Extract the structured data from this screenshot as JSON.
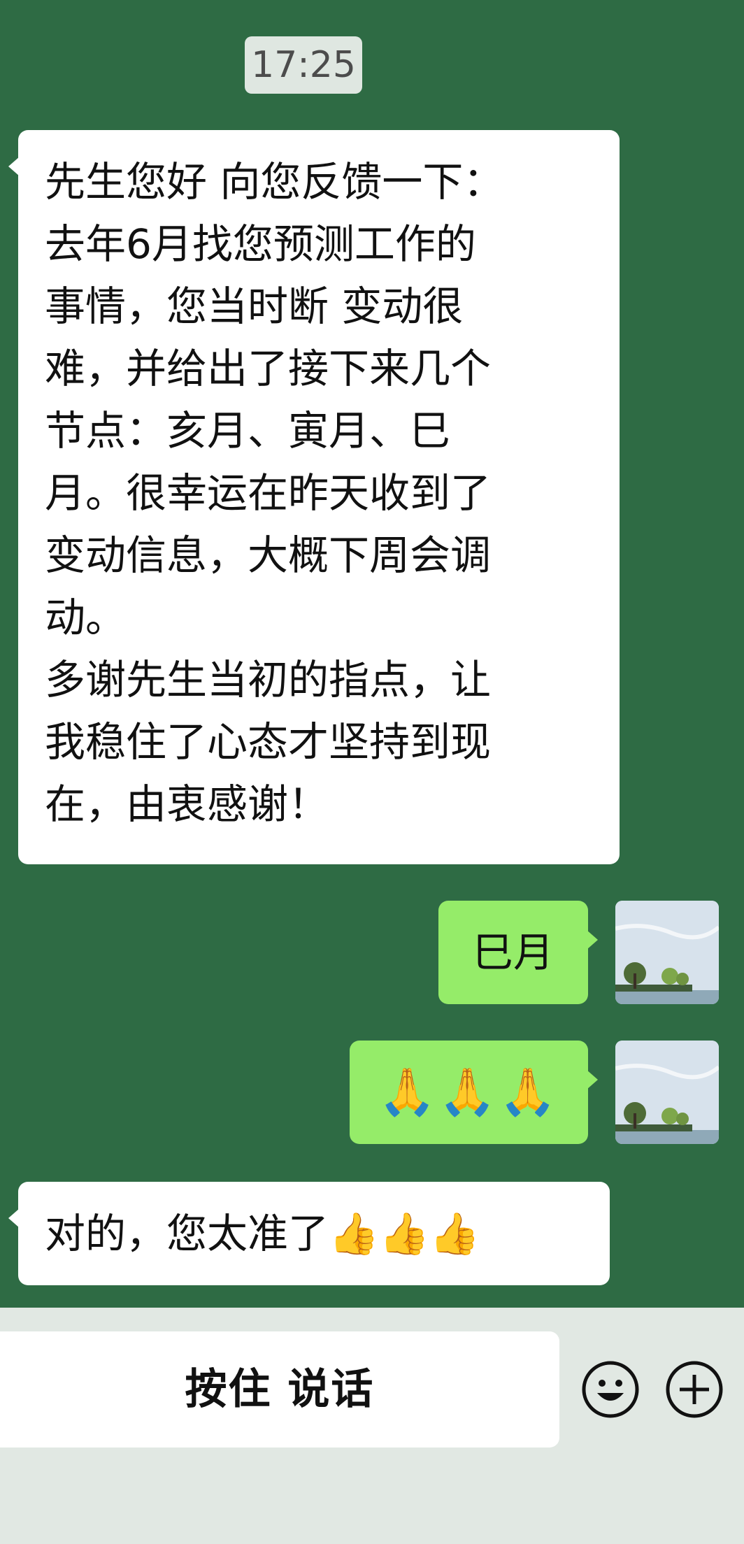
{
  "time": "17:25",
  "messages": [
    {
      "side": "left",
      "text": "先生您好 向您反馈一下：\n去年6月找您预测工作的\n事情，您当时断 变动很\n难，并给出了接下来几个\n节点：亥月、寅月、巳\n月。很幸运在昨天收到了\n变动信息，大概下周会调\n动。\n多谢先生当初的指点，让\n我稳住了心态才坚持到现\n在，由衷感谢！"
    },
    {
      "side": "right",
      "text": "巳月"
    },
    {
      "side": "right",
      "text": "🙏🙏🙏"
    },
    {
      "side": "left",
      "text": "对的，您太准了👍👍👍"
    }
  ],
  "input_bar": {
    "hold_to_talk": "按住 说话",
    "emoji_icon": "smiley-face",
    "plus_icon": "plus-circle"
  },
  "colors": {
    "chat_background": "#2e6b44",
    "incoming_bubble": "#ffffff",
    "outgoing_bubble": "#95ec69",
    "bottom_bar": "#e1e8e3"
  }
}
